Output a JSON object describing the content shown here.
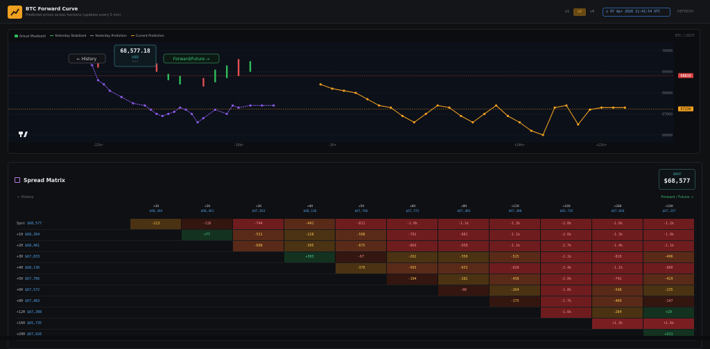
{
  "header": {
    "title": "BTC Forward Curve",
    "subtitle": "Predicted prices across horizons (updates every 5 min)",
    "timeframes": [
      "v1",
      "v2",
      "v4"
    ],
    "active_timeframe": "v2",
    "clock": "07 Apr 2026 11:41:54 UTC",
    "refresh_label": "REFRESH"
  },
  "chart": {
    "pair": "BTC / USDT",
    "legend": [
      {
        "label": "Actual (Realized)",
        "color": "#2fbf5a"
      },
      {
        "label": "Yesterday Stabilized",
        "color": "#2fbf5a"
      },
      {
        "label": "Yesterday Prediction",
        "color": "#8a8f98"
      },
      {
        "label": "Current Prediction",
        "color": "#f0a020"
      }
    ],
    "history_label": "← History",
    "forward_label": "Forward/Future →",
    "tooltip_price": "68,577.18",
    "tooltip_unit": "USD",
    "tooltip_sub": "SPOT",
    "hline_red": "68819",
    "hline_orange": "67236",
    "colors": {
      "red": "#e05050",
      "orange": "#f0a020",
      "purple": "#8a5ae8",
      "green": "#2fbf5a"
    }
  },
  "chart_data": {
    "type": "line",
    "x_ticks": [
      "-22hr",
      "-10hr",
      "-2hr",
      "+14hr",
      "+21hr"
    ],
    "y_ticks": [
      "70000",
      "69000",
      "68000",
      "67000",
      "66000"
    ],
    "ylim": [
      65800,
      70500
    ],
    "xlim": [
      -27,
      26
    ],
    "series": [
      {
        "name": "Yesterday Prediction",
        "x": [
          -24,
          -23,
          -22.5,
          -22,
          -21.5,
          -21,
          -20,
          -19,
          -18,
          -17.5,
          -17,
          -16.5,
          -16,
          -15.5,
          -15,
          -14.5,
          -14,
          -13.5,
          -13,
          -12,
          -11,
          -10.5,
          -10,
          -9,
          -8,
          -7
        ],
        "y": [
          69800,
          69600,
          69300,
          68600,
          68400,
          68100,
          67800,
          67500,
          67400,
          67200,
          67000,
          66900,
          67000,
          67100,
          67300,
          67200,
          67000,
          66600,
          66800,
          67200,
          67000,
          67400,
          67300,
          67400,
          67400,
          67400
        ]
      },
      {
        "name": "Current Prediction",
        "x": [
          -3,
          -2,
          -1,
          0,
          1,
          2,
          3,
          4,
          5,
          6,
          7,
          8,
          9,
          10,
          11,
          12,
          13,
          14,
          15,
          16,
          17,
          18,
          19,
          20,
          21,
          22,
          23
        ],
        "y": [
          68400,
          68200,
          68100,
          68000,
          67700,
          67400,
          67300,
          66900,
          66600,
          67000,
          67400,
          67300,
          66900,
          66600,
          67000,
          67400,
          66900,
          66600,
          66200,
          66000,
          67300,
          67400,
          66500,
          67200,
          67300,
          67300,
          67300
        ]
      }
    ]
  },
  "spread": {
    "title": "Spread Matrix",
    "spot_label": "SPOT",
    "spot_value": "$68,577",
    "history_label": "← History",
    "forward_label": "Forward / Future →",
    "columns": [
      {
        "h": "+1H",
        "p": "$68,364"
      },
      {
        "h": "+2H",
        "p": "$68,461"
      },
      {
        "h": "+3H",
        "p": "$67,833"
      },
      {
        "h": "+4H",
        "p": "$68,136"
      },
      {
        "h": "+5H",
        "p": "$67,766"
      },
      {
        "h": "+6H",
        "p": "$67,572"
      },
      {
        "h": "+8H",
        "p": "$67,483"
      },
      {
        "h": "+12H",
        "p": "$67,388"
      },
      {
        "h": "+16H",
        "p": "$65,735"
      },
      {
        "h": "+20H",
        "p": "$67,026"
      },
      {
        "h": "+24H",
        "p": "$67,337"
      }
    ],
    "rows": [
      {
        "n": "Spot",
        "v": "$68,577",
        "cells": [
          "-213",
          "-116",
          "-744",
          "-441",
          "-811",
          "-1.0k",
          "-1.1k",
          "-1.3k",
          "-2.8k",
          "-1.6k",
          "-1.2k"
        ]
      },
      {
        "n": "+1H",
        "v": "$68,364",
        "cells": [
          null,
          "+77",
          "-531",
          "-228",
          "-598",
          "-792",
          "-881",
          "-1.1k",
          "-2.6k",
          "-1.3k",
          "-1.0k"
        ]
      },
      {
        "n": "+2H",
        "v": "$68,461",
        "cells": [
          null,
          null,
          "-608",
          "-305",
          "-675",
          "-869",
          "-958",
          "-1.1k",
          "-2.7k",
          "-1.4k",
          "-1.1k"
        ]
      },
      {
        "n": "+3H",
        "v": "$67,833",
        "cells": [
          null,
          null,
          null,
          "+303",
          "-67",
          "-262",
          "-350",
          "-525",
          "-2.1k",
          "-810",
          "-496"
        ]
      },
      {
        "n": "+4H",
        "v": "$68,136",
        "cells": [
          null,
          null,
          null,
          null,
          "-370",
          "-565",
          "-653",
          "-828",
          "-2.4k",
          "-1.1k",
          "-800"
        ]
      },
      {
        "n": "+5H",
        "v": "$67,766",
        "cells": [
          null,
          null,
          null,
          null,
          null,
          "-194",
          "-282",
          "-458",
          "-2.0k",
          "-742",
          "-429"
        ]
      },
      {
        "n": "+6H",
        "v": "$67,572",
        "cells": [
          null,
          null,
          null,
          null,
          null,
          null,
          "-88",
          "-264",
          "-1.8k",
          "-548",
          "-235"
        ]
      },
      {
        "n": "+8H",
        "v": "$67,483",
        "cells": [
          null,
          null,
          null,
          null,
          null,
          null,
          null,
          "-175",
          "-1.7k",
          "-460",
          "-147"
        ]
      },
      {
        "n": "+12H",
        "v": "$67,308",
        "cells": [
          null,
          null,
          null,
          null,
          null,
          null,
          null,
          null,
          "-1.6k",
          "-284",
          "+29"
        ]
      },
      {
        "n": "+16H",
        "v": "$65,735",
        "cells": [
          null,
          null,
          null,
          null,
          null,
          null,
          null,
          null,
          null,
          "+1.3k",
          "+1.6k"
        ]
      },
      {
        "n": "+20H",
        "v": "$67,026",
        "cells": [
          null,
          null,
          null,
          null,
          null,
          null,
          null,
          null,
          null,
          null,
          "+311"
        ]
      }
    ]
  }
}
